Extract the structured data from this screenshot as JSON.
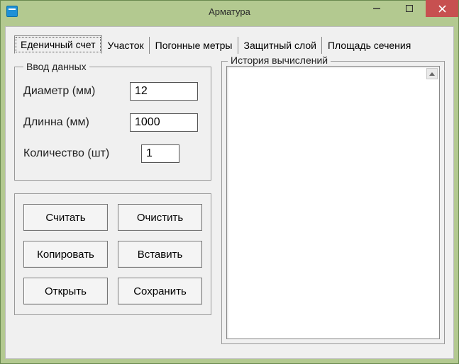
{
  "window": {
    "title": "Арматура"
  },
  "tabs": [
    {
      "label": "Еденичный счет",
      "active": true
    },
    {
      "label": "Участок",
      "active": false
    },
    {
      "label": "Погонные метры",
      "active": false
    },
    {
      "label": "Защитный слой",
      "active": false
    },
    {
      "label": "Площадь сечения",
      "active": false
    }
  ],
  "input_group": {
    "legend": "Ввод данных",
    "diameter_label": "Диаметр (мм)",
    "diameter_value": "12",
    "length_label": "Длинна   (мм)",
    "length_value": "1000",
    "quantity_label": "Количество (шт)",
    "quantity_value": "1"
  },
  "buttons": {
    "calculate": "Считать",
    "clear": "Очистить",
    "copy": "Копировать",
    "paste": "Вставить",
    "open": "Открыть",
    "save": "Сохранить"
  },
  "history": {
    "legend": "История вычислений"
  }
}
